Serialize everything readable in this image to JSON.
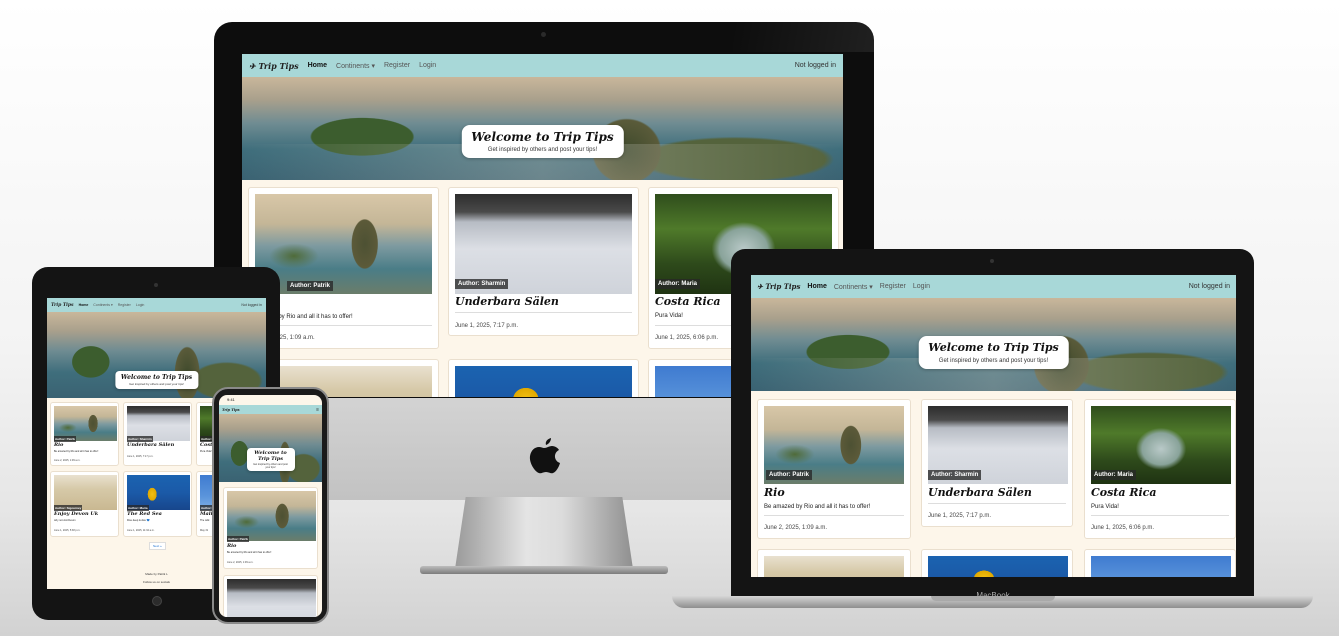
{
  "site": {
    "brand": "Trip Tips",
    "nav": {
      "home": "Home",
      "continents": "Continents ▾",
      "register": "Register",
      "login": "Login",
      "status": "Not logged in"
    },
    "hero": {
      "title": "Welcome to Trip Tips",
      "subtitle": "Get inspired by others and post your tips!"
    },
    "posts": [
      {
        "author": "Author: Patrik",
        "title": "Rio",
        "excerpt": "Be amazed by Rio and all it has to offer!",
        "date": "June 2, 2025, 1:09 a.m."
      },
      {
        "author": "Author: Sharmin",
        "title": "Underbara Sälen",
        "excerpt": "",
        "date": "June 1, 2025, 7:17 p.m."
      },
      {
        "author": "Author: Maria",
        "title": "Costa Rica",
        "excerpt": "Pura Vida!",
        "date": "June 1, 2025, 6:06 p.m."
      },
      {
        "author": "Author: Sigourney",
        "title": "Enjoy Devon Uk",
        "excerpt": "why not visit Devon",
        "date": "June 1, 2025, 5:38 p.m."
      },
      {
        "author": "Author: Maria",
        "title": "The Red Sea",
        "excerpt": "Dive deep & dive 💙",
        "date": "June 1, 2025, 11:34 a.m."
      },
      {
        "author": "Author:",
        "title": "Mali",
        "excerpt": "The wild",
        "date": "May 31"
      }
    ],
    "pagination": {
      "next": "Next »"
    },
    "footer": {
      "made_by": "Made by Patrik L",
      "follow": "Follow us on socials"
    },
    "imac_visible_date_rio": "June 2, 2025, 1:09 a.m.",
    "imac_visible_author_rio": "Patrik",
    "imac_visible_excerpt_rio": "zed by Rio and all it has to offer!",
    "imac_visible_date_rio_partial": "2025, 1:09 a.m."
  },
  "phone": {
    "time": "9:41"
  },
  "laptop": {
    "label": "MacBook"
  }
}
